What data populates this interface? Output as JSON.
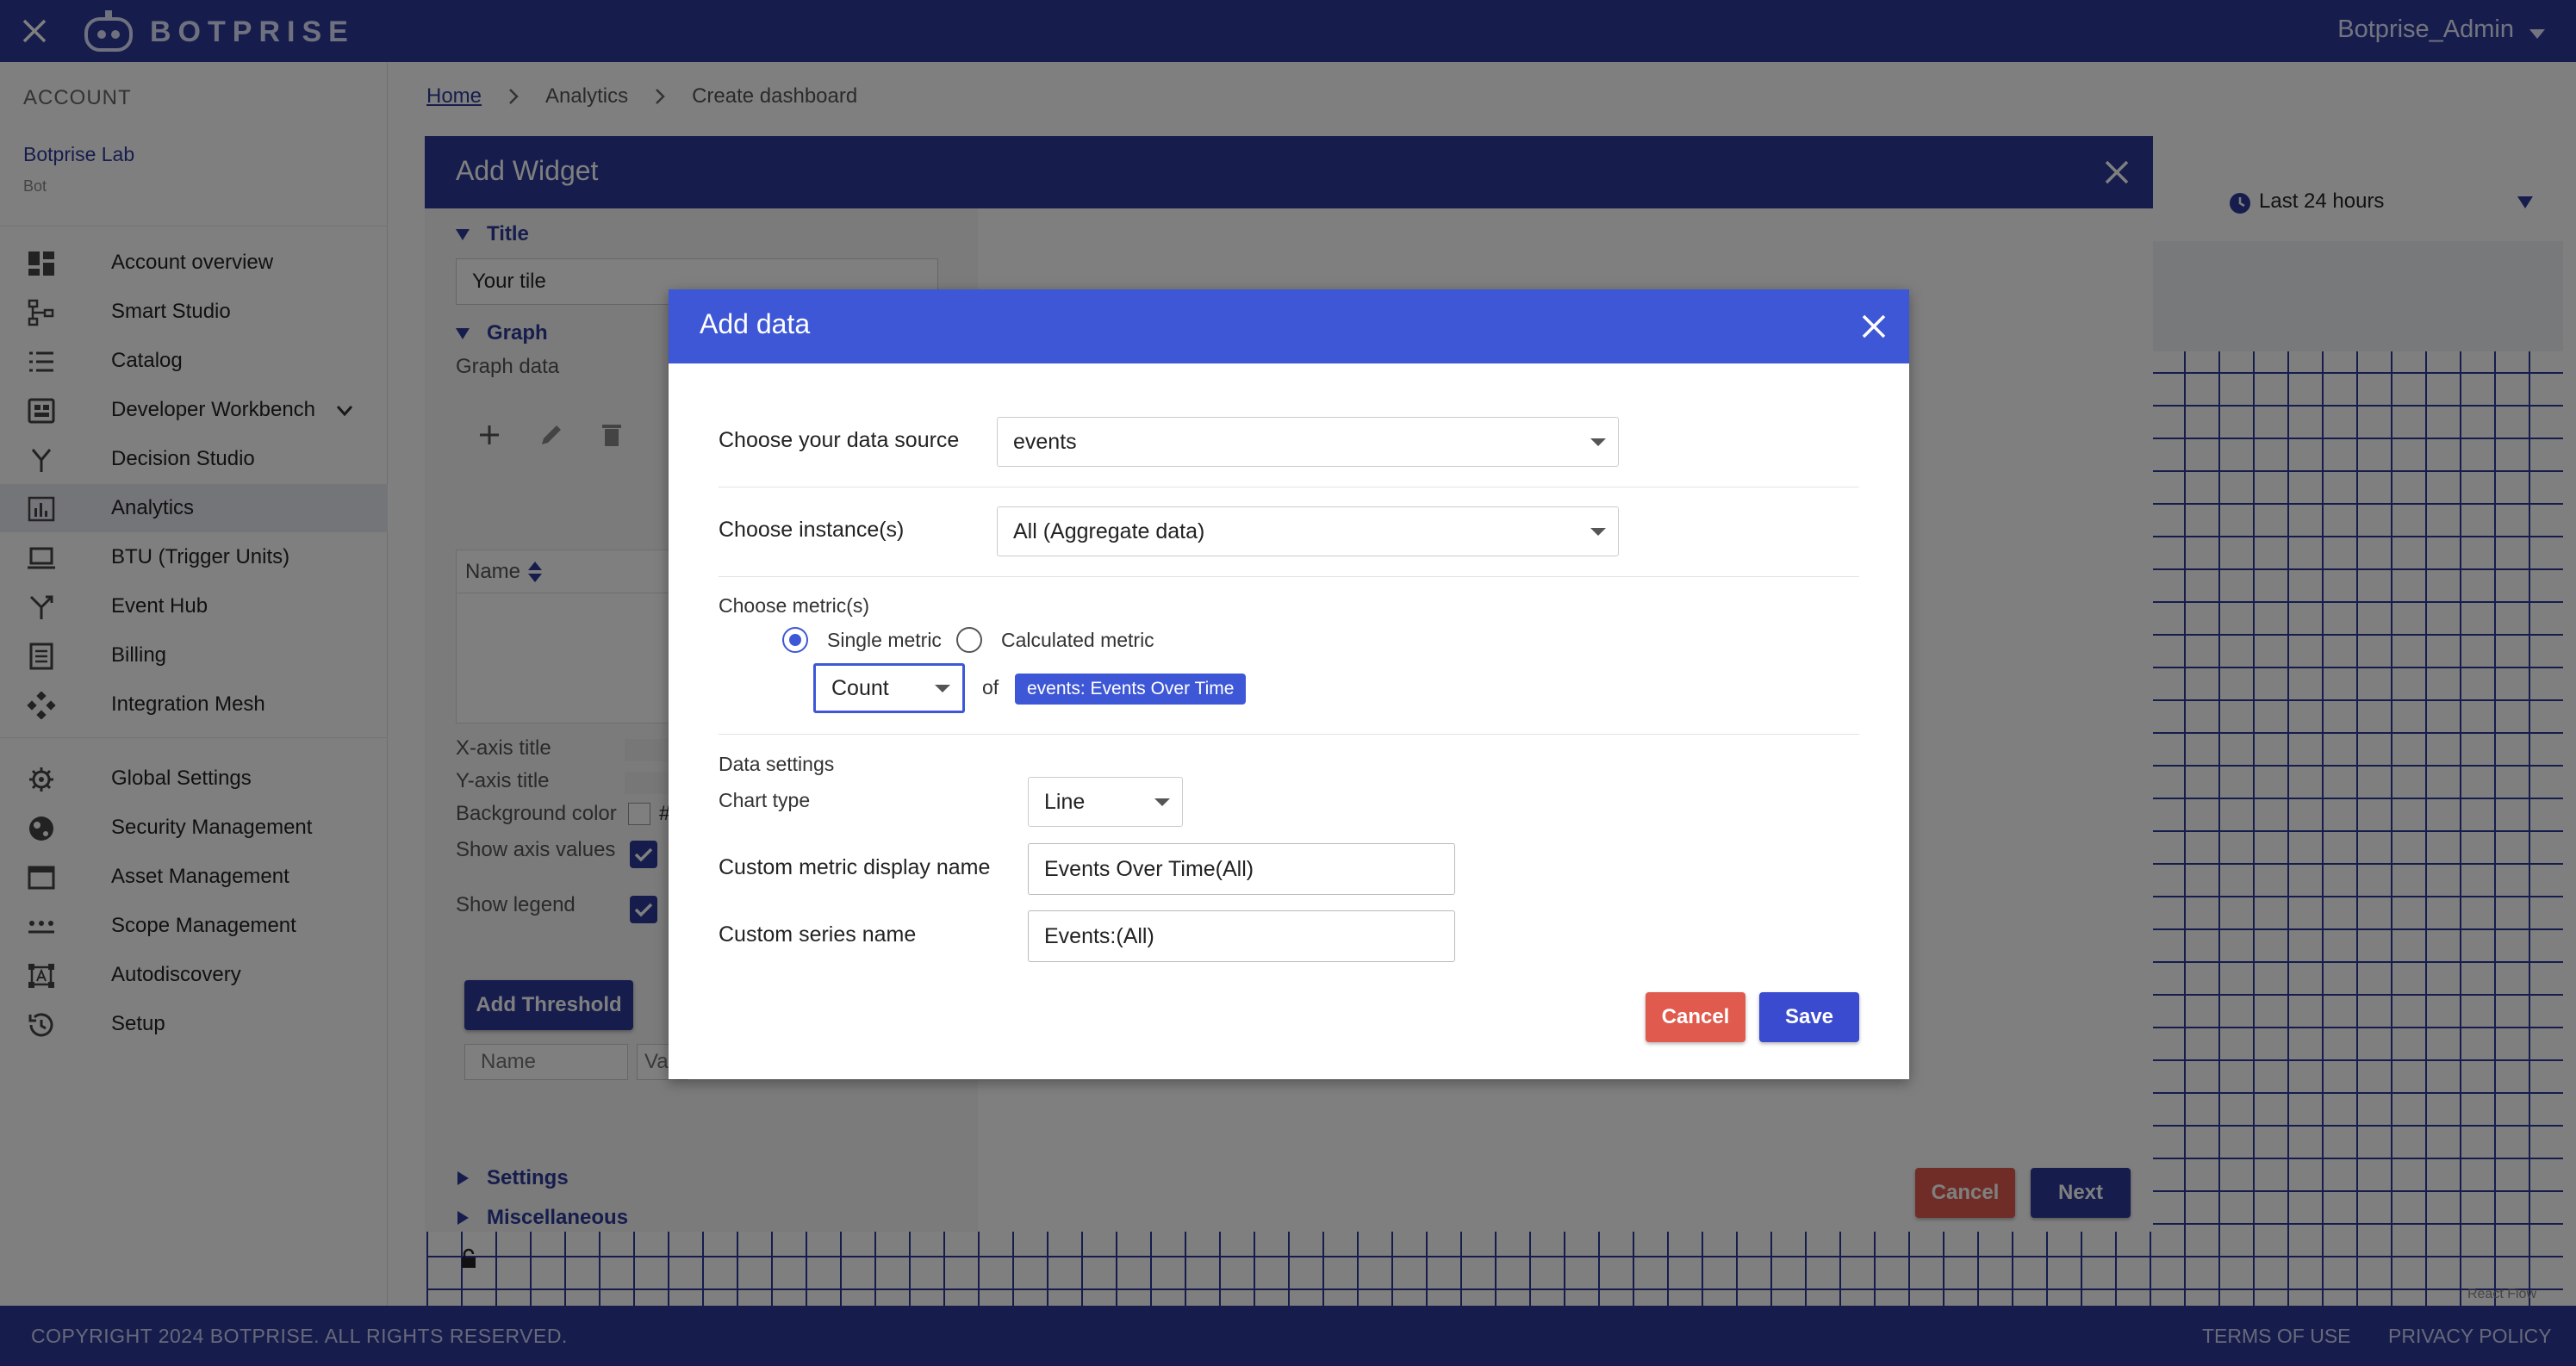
{
  "header": {
    "brand": "BOTPRISE",
    "user": "Botprise_Admin"
  },
  "sidebar": {
    "section": "ACCOUNT",
    "org_name": "Botprise Lab",
    "org_type": "Bot",
    "items": [
      {
        "label": "Account overview",
        "icon": "dashboard-icon"
      },
      {
        "label": "Smart Studio",
        "icon": "flow-icon"
      },
      {
        "label": "Catalog",
        "icon": "list-icon"
      },
      {
        "label": "Developer Workbench",
        "icon": "workbench-icon"
      },
      {
        "label": "Decision Studio",
        "icon": "branch-icon"
      },
      {
        "label": "Analytics",
        "icon": "chart-icon"
      },
      {
        "label": "BTU (Trigger Units)",
        "icon": "laptop-icon"
      },
      {
        "label": "Event Hub",
        "icon": "fork-icon"
      },
      {
        "label": "Billing",
        "icon": "document-icon"
      },
      {
        "label": "Integration Mesh",
        "icon": "mesh-icon"
      },
      {
        "label": "Global Settings",
        "icon": "gear-icon"
      },
      {
        "label": "Security Management",
        "icon": "globe-icon"
      },
      {
        "label": "Asset Management",
        "icon": "window-icon"
      },
      {
        "label": "Scope Management",
        "icon": "dots-icon"
      },
      {
        "label": "Autodiscovery",
        "icon": "scan-icon"
      },
      {
        "label": "Setup",
        "icon": "history-icon"
      }
    ]
  },
  "breadcrumb": {
    "home": "Home",
    "analytics": "Analytics",
    "current": "Create dashboard"
  },
  "time_range": "Last 24 hours",
  "react_flow_attribution": "React Flow",
  "footer": {
    "copyright": "COPYRIGHT 2024 BOTPRISE. ALL RIGHTS RESERVED.",
    "terms": "TERMS OF USE",
    "privacy": "PRIVACY POLICY"
  },
  "widget": {
    "title": "Add Widget",
    "title_section": "Title",
    "title_value": "Your tile",
    "graph_section": "Graph",
    "graph_data": "Graph data",
    "name_col": "Name",
    "x_axis": "X-axis title",
    "y_axis": "Y-axis title",
    "bg_color": "Background color",
    "bg_color_value": "#",
    "show_axis": "Show axis values",
    "show_legend": "Show legend",
    "add_threshold": "Add Threshold",
    "threshold_name_placeholder": "Name",
    "threshold_value_placeholder": "Val",
    "settings": "Settings",
    "misc": "Miscellaneous",
    "cancel": "Cancel",
    "next": "Next"
  },
  "dialog": {
    "title": "Add data",
    "data_source_label": "Choose your data source",
    "data_source_value": "events",
    "instances_label": "Choose instance(s)",
    "instances_value": "All (Aggregate data)",
    "metrics_label": "Choose metric(s)",
    "single_metric": "Single metric",
    "calculated_metric": "Calculated metric",
    "aggregation": "Count",
    "of": "of",
    "metric_chip": "events: Events Over Time",
    "data_settings": "Data settings",
    "chart_type_label": "Chart type",
    "chart_type_value": "Line",
    "display_name_label": "Custom metric display name",
    "display_name_value": "Events Over Time(All)",
    "series_name_label": "Custom series name",
    "series_name_value": "Events:(All)",
    "cancel": "Cancel",
    "save": "Save"
  },
  "colors": {
    "primary": "#2c3b9a",
    "dialog_header": "#3e57d6",
    "danger": "#e05a4e"
  }
}
